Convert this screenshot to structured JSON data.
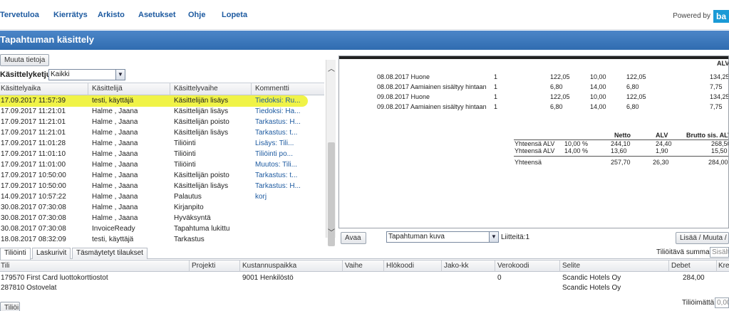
{
  "nav": {
    "items": [
      "Tervetuloa",
      "Kierrätys",
      "Arkisto",
      "Asetukset",
      "Ohje",
      "Lopeta"
    ],
    "powered_by": "Powered by",
    "logo_text": "ba"
  },
  "page": {
    "title": "Tapahtuman käsittely"
  },
  "left": {
    "edit_button": "Muuta tietoja",
    "chain_label": "Käsittelyketju",
    "chain_value": "Kaikki",
    "columns": [
      "Käsittelyaika",
      "Käsittelijä",
      "Käsittelyvaihe",
      "Kommentti"
    ],
    "rows": [
      [
        "17.09.2017 11:57:39",
        "testi, käyttäjä",
        "Käsittelijän lisäys",
        "Tiedoksi: Ru..."
      ],
      [
        "17.09.2017 11:21:01",
        "Halme , Jaana",
        "Käsittelijän lisäys",
        "Tiedoksi: Ha..."
      ],
      [
        "17.09.2017 11:21:01",
        "Halme , Jaana",
        "Käsittelijän poisto",
        "Tarkastus: H..."
      ],
      [
        "17.09.2017 11:21:01",
        "Halme , Jaana",
        "Käsittelijän lisäys",
        "Tarkastus: t..."
      ],
      [
        "17.09.2017 11:01:28",
        "Halme , Jaana",
        "Tiliöinti",
        "Lisäys: Tili..."
      ],
      [
        "17.09.2017 11:01:10",
        "Halme , Jaana",
        "Tiliöinti",
        "Tiliöinti po..."
      ],
      [
        "17.09.2017 11:01:00",
        "Halme , Jaana",
        "Tiliöinti",
        "Muutos: Tili..."
      ],
      [
        "17.09.2017 10:50:00",
        "Halme , Jaana",
        "Käsittelijän poisto",
        "Tarkastus: t..."
      ],
      [
        "17.09.2017 10:50:00",
        "Halme , Jaana",
        "Käsittelijän lisäys",
        "Tarkastus: H..."
      ],
      [
        "14.09.2017 10:57:22",
        "Halme , Jaana",
        "Palautus",
        "korj"
      ],
      [
        "30.08.2017 07:30:08",
        "Halme , Jaana",
        "Kirjanpito",
        ""
      ],
      [
        "30.08.2017 07:30:08",
        "Halme , Jaana",
        "Hyväksyntä",
        ""
      ],
      [
        "30.08.2017 07:30:08",
        "InvoiceReady",
        "Tapahtuma lukittu",
        ""
      ],
      [
        "18.08.2017 08:32:09",
        "testi, käyttäjä",
        "Tarkastus",
        ""
      ]
    ]
  },
  "doc": {
    "lines": [
      [
        "08.08.2017 Huone",
        "1",
        "122,05",
        "10,00",
        "122,05",
        "134,25"
      ],
      [
        "08.08.2017 Aamiainen sisältyy hintaan",
        "1",
        "6,80",
        "14,00",
        "6,80",
        "7,75"
      ],
      [
        "09.08.2017 Huone",
        "1",
        "122,05",
        "10,00",
        "122,05",
        "134,25"
      ],
      [
        "09.08.2017 Aamiainen sisältyy hintaan",
        "1",
        "6,80",
        "14,00",
        "6,80",
        "7,75"
      ]
    ],
    "totals_header": [
      "Netto",
      "ALV",
      "Brutto sis. ALV"
    ],
    "vat_rows": [
      [
        "Yhteensä ALV",
        "10,00 %",
        "244,10",
        "24,40",
        "268,50"
      ],
      [
        "Yhteensä ALV",
        "14,00 %",
        "13,60",
        "1,90",
        "15,50"
      ]
    ],
    "grand_total": [
      "Yhteensä",
      "257,70",
      "26,30",
      "284,00"
    ],
    "top_header_frag": "ALV"
  },
  "doc_toolbar": {
    "open_button": "Avaa",
    "view_select": "Tapahtuman kuva",
    "attachments": "Liitteitä:1",
    "add_button": "Lisää / Muuta / S"
  },
  "bottom": {
    "tabs": [
      "Tiliöinti",
      "Laskurivit",
      "Täsmäytetyt tilaukset"
    ],
    "sum_label": "Tiliöitävä summa",
    "sum_value": "Sisältä",
    "columns": [
      "Tili",
      "Projekti",
      "Kustannuspaikka",
      "Vaihe",
      "Hlökoodi",
      "Jako-kk",
      "Verokoodi",
      "Selite",
      "Debet",
      "Kre"
    ],
    "rows": [
      [
        "179570 First Card luottokorttiostot",
        "",
        "9001 Henkilöstö",
        "",
        "",
        "",
        "0",
        "Scandic Hotels Oy",
        "284,00",
        ""
      ],
      [
        "287810 Ostovelat",
        "",
        "",
        "",
        "",
        "",
        "",
        "Scandic Hotels Oy",
        "",
        ""
      ]
    ],
    "post_button": "Tiliöi",
    "unposted_label": "Tiliöimättä",
    "unposted_value": "0,00"
  }
}
